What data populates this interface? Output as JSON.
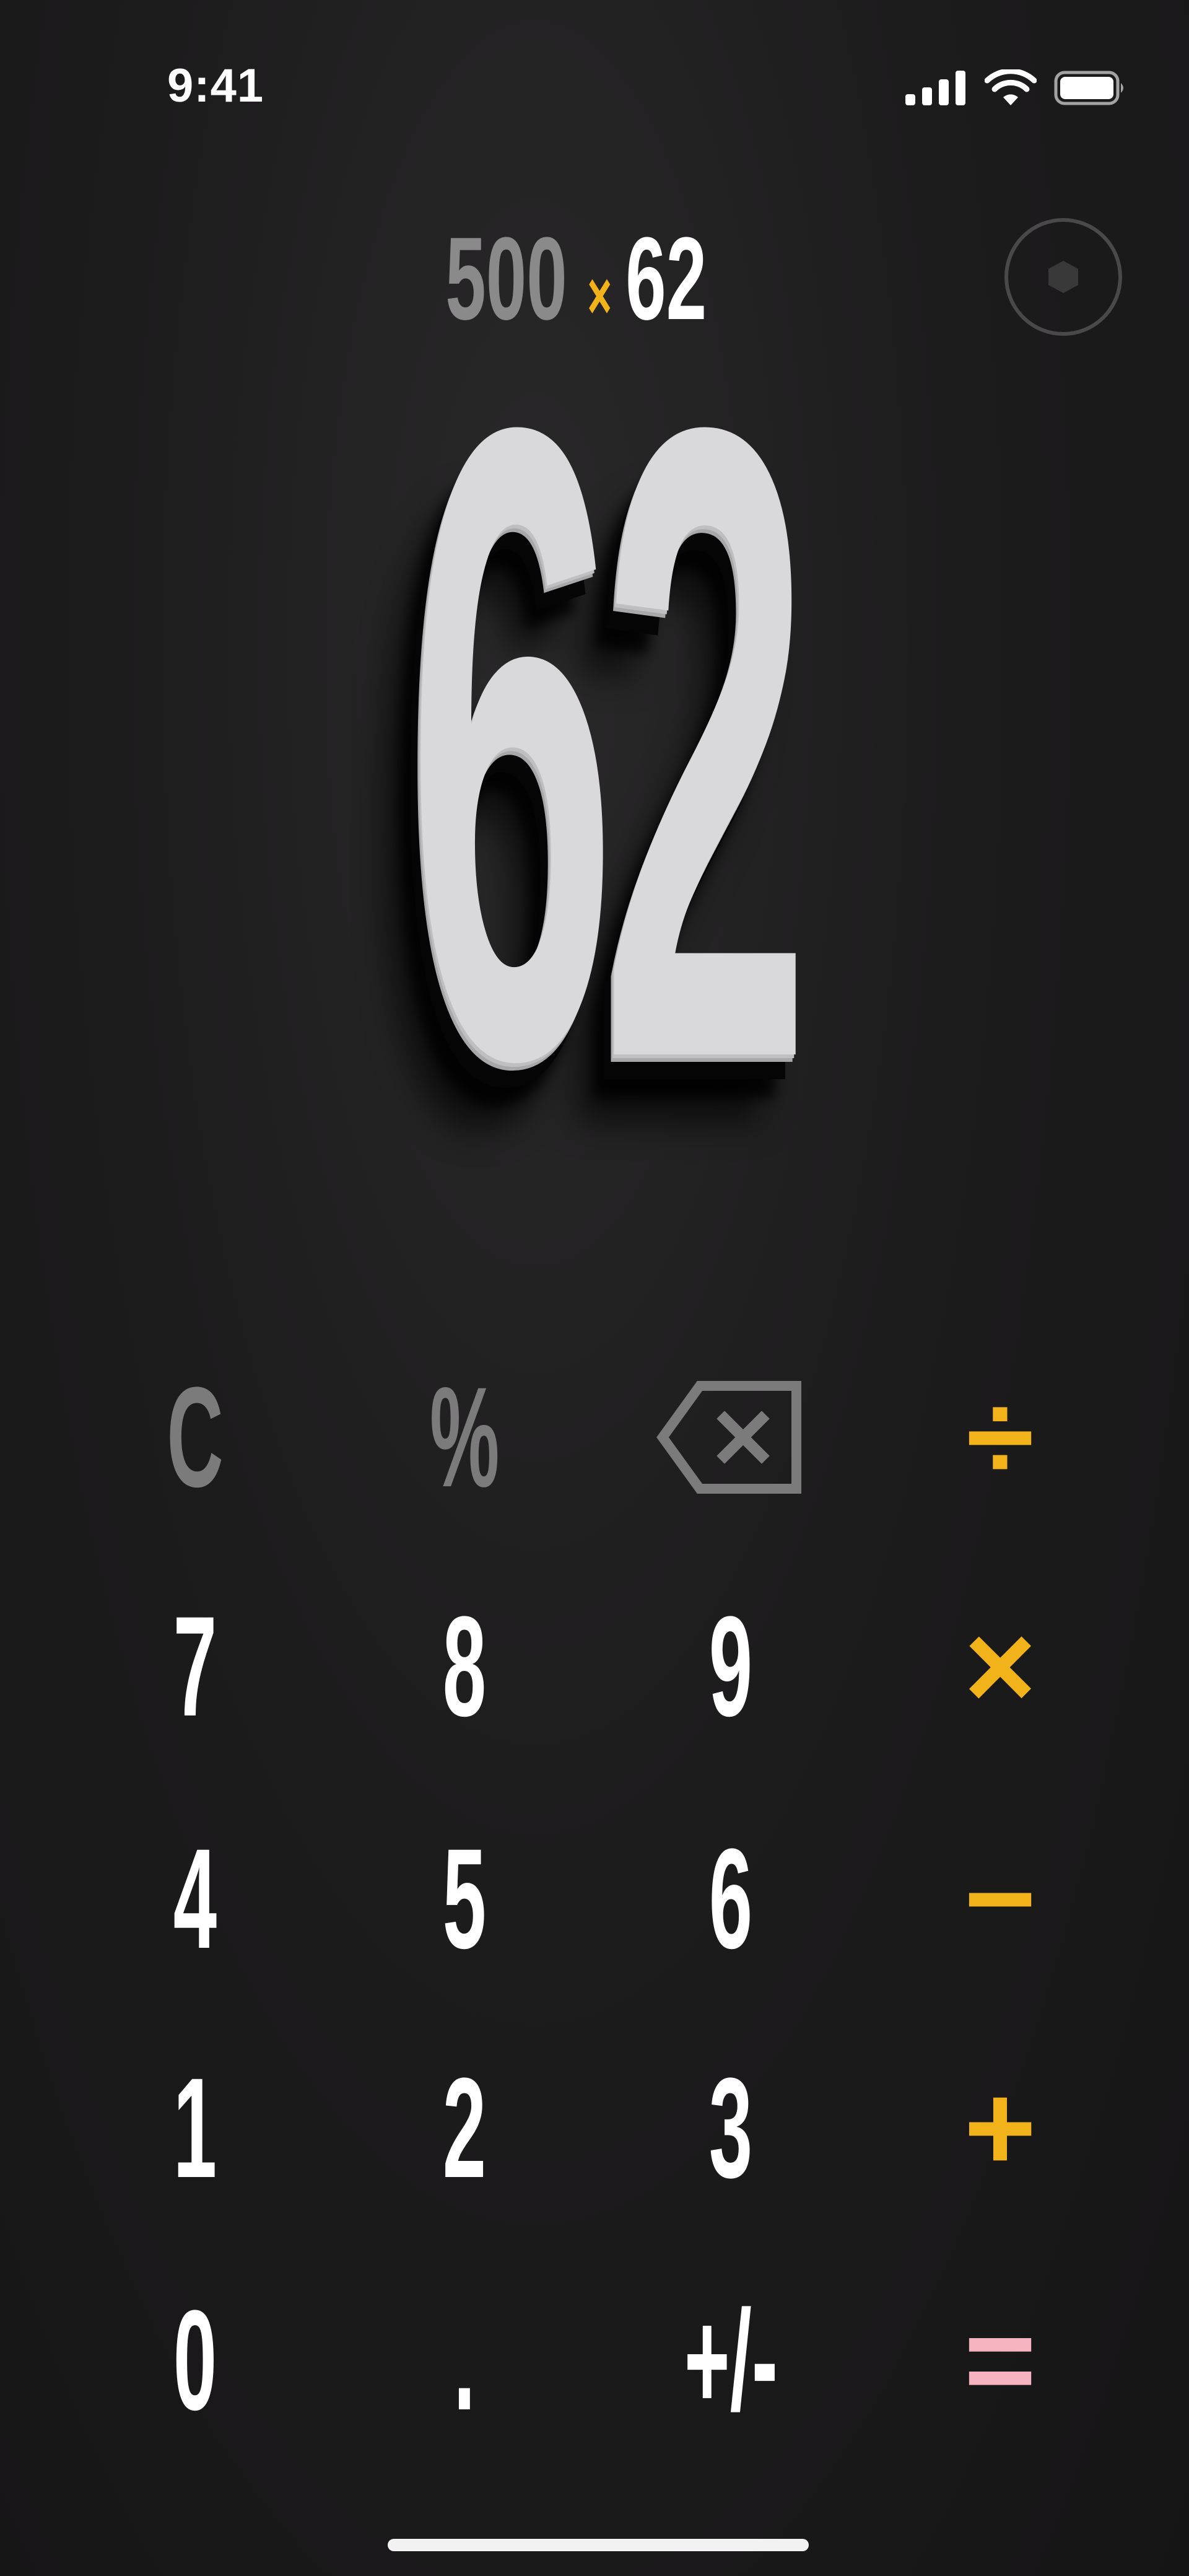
{
  "status_bar": {
    "time": "9:41",
    "icons": [
      "signal-icon",
      "wifi-icon",
      "battery-icon"
    ]
  },
  "expression": {
    "operand1": "500",
    "operator": "×",
    "operand2": "62"
  },
  "result": "62",
  "keypad": {
    "row1": [
      "C",
      "%",
      "backspace",
      "÷"
    ],
    "row2": [
      "7",
      "8",
      "9",
      "×"
    ],
    "row3": [
      "4",
      "5",
      "6",
      "−"
    ],
    "row4": [
      "1",
      "2",
      "3",
      "+"
    ],
    "row5": [
      "0",
      ".",
      "+/-",
      "="
    ]
  },
  "colors": {
    "background": "#1b1a1b",
    "accent_operator": "#f2b21a",
    "equals": "#f4b3bf",
    "function_key": "#7b7b7b",
    "digit_key": "#ffffff",
    "result": "#d9d8da"
  }
}
